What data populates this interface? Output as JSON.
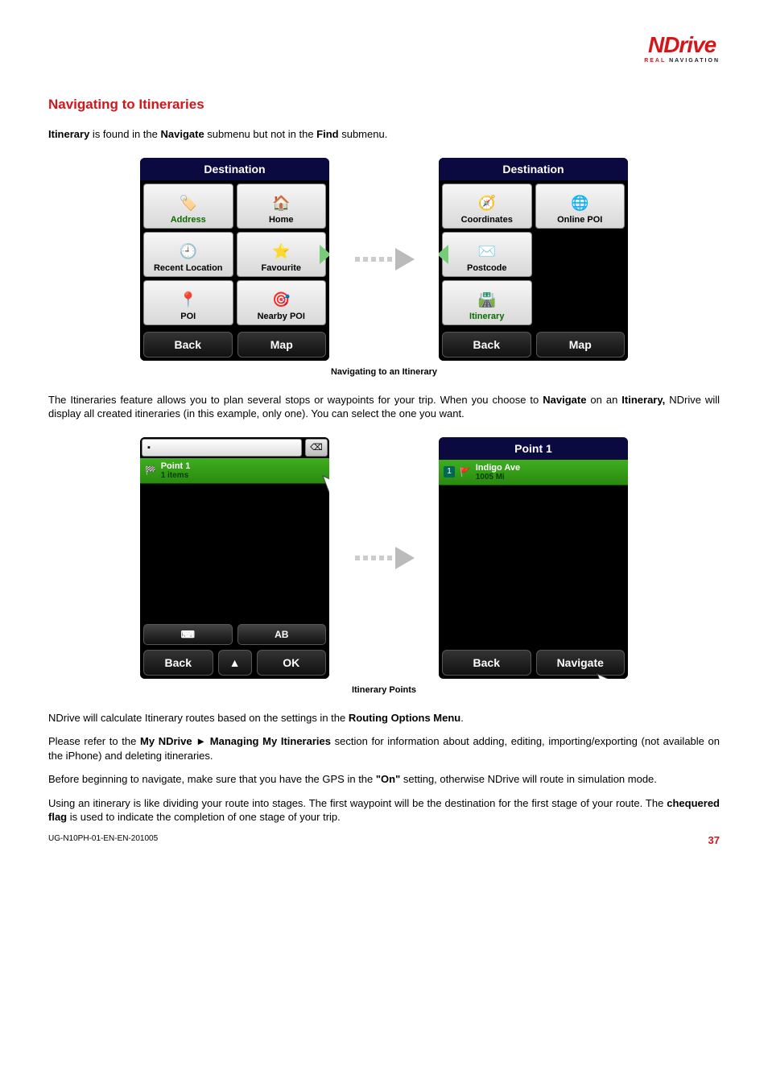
{
  "logo": {
    "brand_n": "N",
    "brand_rest": "Drive",
    "tag_real": "REAL",
    "tag_nav": "NAVIGATION"
  },
  "title": "Navigating to Itineraries",
  "intro_a": "Itinerary",
  "intro_b": " is found in the ",
  "intro_c": "Navigate",
  "intro_d": " submenu but not in the ",
  "intro_e": "Find",
  "intro_f": " submenu.",
  "fig1_header": "Destination",
  "tiles1": {
    "address": "Address",
    "home": "Home",
    "recent": "Recent Location",
    "fav": "Favourite",
    "poi": "POI",
    "nearby": "Nearby POI",
    "coords": "Coordinates",
    "online": "Online POI",
    "postcode": "Postcode",
    "itinerary": "Itinerary"
  },
  "btn_back": "Back",
  "btn_map": "Map",
  "btn_ok": "OK",
  "btn_nav": "Navigate",
  "fig1_caption": "Navigating to an Itinerary",
  "para2_a": "The Itineraries feature allows you to plan several stops or waypoints for your trip. When you choose to ",
  "para2_b": "Navigate",
  "para2_c": " on an ",
  "para2_d": "Itinerary,",
  "para2_e": " NDrive will display all created itineraries (in this example, only one). You can select the one you want.",
  "list1_title": "Point 1",
  "list1_sub": "1 items",
  "screenB_header": "Point 1",
  "listB_num": "1",
  "listB_t1": "Indigo Ave",
  "listB_t2": "1005 Mi",
  "kb_ab": "AB",
  "fig2_caption": "Itinerary Points",
  "para3_a": "NDrive will calculate Itinerary routes based on the settings in the ",
  "para3_b": "Routing Options Menu",
  "para3_c": ".",
  "para4_a": "Please refer to the ",
  "para4_b": "My NDrive ► Managing My Itineraries",
  "para4_c": " section for information about adding, editing, importing/exporting (not available on the iPhone) and deleting itineraries.",
  "para5_a": "Before beginning to navigate, make sure that you have the GPS in the ",
  "para5_b": "\"On\"",
  "para5_c": " setting, otherwise NDrive will route in simulation mode.",
  "para6_a": "Using an itinerary is like dividing your route into stages. The first waypoint will be the destination for the first stage of your route. The ",
  "para6_b": "chequered flag",
  "para6_c": " is used to indicate the completion of one stage of your trip.",
  "footer_code": "UG-N10PH-01-EN-EN-201005",
  "footer_page": "37"
}
